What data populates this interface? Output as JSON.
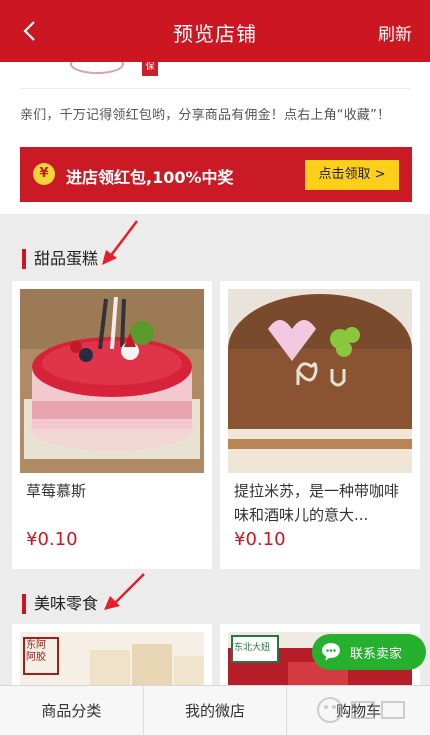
{
  "header": {
    "title": "预览店铺",
    "refresh_label": "刷新"
  },
  "shop": {
    "logo_seal_char": "保",
    "notice": "亲们，千万记得领红包哟，分享商品有佣金！点右上角“收藏”！"
  },
  "banner": {
    "coin_icon": "yuan-coin-icon",
    "coin_symbol": "¥",
    "text": "进店领红包,100%中奖",
    "button_label": "点击领取 >"
  },
  "sections": [
    {
      "title": "甜品蛋糕",
      "products": [
        {
          "name": "草莓慕斯",
          "price": "¥0.10"
        },
        {
          "name": "提拉米苏，是一种带咖啡味和酒味儿的意大...",
          "price": "¥0.10"
        }
      ]
    },
    {
      "title": "美味零食",
      "products": [
        {
          "image_text": "东阿阿胶"
        },
        {
          "image_text": "东北大妞"
        }
      ]
    }
  ],
  "chat": {
    "label": "联系卖家",
    "icon": "chat-bubble-icon"
  },
  "bottom_nav": {
    "tabs": [
      "商品分类",
      "我的微店",
      "购物车"
    ]
  },
  "colors": {
    "brand_red": "#cc1622",
    "banner_button": "#fccf1b",
    "chat_green": "#25b12e"
  }
}
